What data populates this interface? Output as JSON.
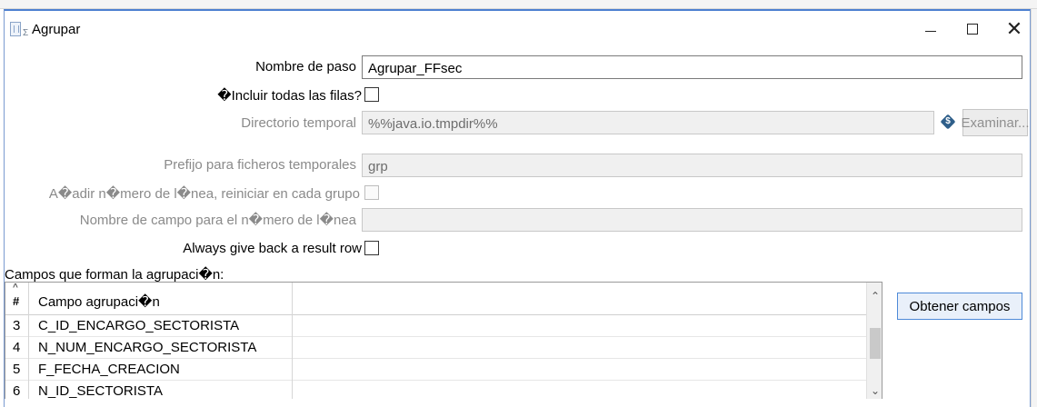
{
  "window": {
    "title": "Agrupar",
    "icon": "group-step-icon",
    "icon_sub": "Σ",
    "controls": {
      "minimize": "minimize-icon",
      "maximize": "maximize-icon",
      "close": "close-icon"
    }
  },
  "form": {
    "step_name": {
      "label": "Nombre de paso",
      "value": "Agrupar_FFsec"
    },
    "include_all_rows": {
      "label": "�Incluir todas las filas?",
      "checked": false
    },
    "temp_dir": {
      "label": "Directorio temporal",
      "value": "%%java.io.tmpdir%%",
      "browse_label": "Examinar...",
      "variable_icon": "variable-dollar-icon"
    },
    "temp_prefix": {
      "label": "Prefijo para ficheros temporales",
      "value": "grp"
    },
    "add_line_number": {
      "label": "A�adir n�mero de l�nea, reiniciar en cada grupo",
      "checked": false
    },
    "line_number_field": {
      "label": "Nombre de campo para el n�mero de l�nea",
      "value": ""
    },
    "always_result_row": {
      "label": "Always give back a result row",
      "checked": false
    }
  },
  "group_fields": {
    "section_label": "Campos que forman la agrupaci�n:",
    "get_fields_label": "Obtener campos",
    "columns": {
      "num": "#",
      "field": "Campo agrupaci�n"
    },
    "rows": [
      {
        "num": "3",
        "field": "C_ID_ENCARGO_SECTORISTA"
      },
      {
        "num": "4",
        "field": "N_NUM_ENCARGO_SECTORISTA"
      },
      {
        "num": "5",
        "field": "F_FECHA_CREACION"
      },
      {
        "num": "6",
        "field": "N_ID_SECTORISTA"
      }
    ]
  }
}
